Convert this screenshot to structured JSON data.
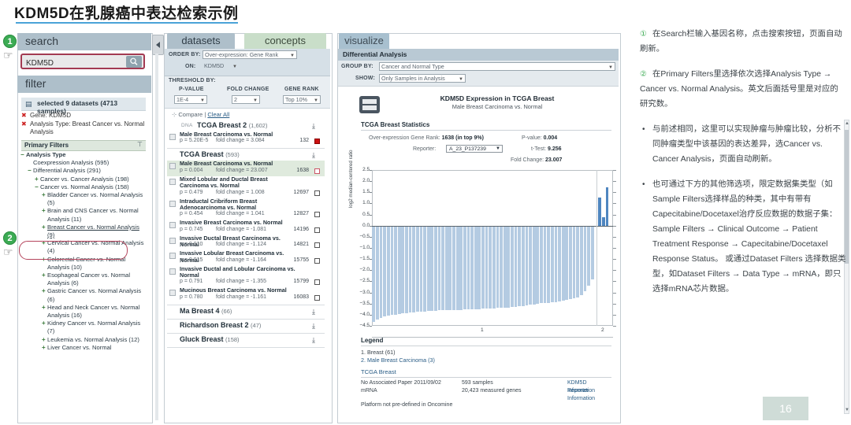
{
  "slide": {
    "title": "KDM5D在乳腺癌中表达检索示例",
    "page_number": "16"
  },
  "steps": [
    {
      "number": "1"
    },
    {
      "number": "2"
    }
  ],
  "search_panel": {
    "header": "search",
    "input_value": "KDM5D",
    "input_placeholder": "KDM5D",
    "search_icon": "search-icon",
    "filter_header": "filter",
    "selected_summary": "selected 9 datasets (4713 samples)",
    "selected_filters": [
      "Gene: KDM5D",
      "Analysis Type: Breast Cancer vs. Normal Analysis"
    ],
    "primary_filters_label": "Primary Filters",
    "tree": [
      {
        "indent": 0,
        "toggle": "−",
        "label": "Analysis Type",
        "bold": true
      },
      {
        "indent": 1,
        "toggle": "",
        "label": "Coexpression Analysis (595)",
        "bold": false
      },
      {
        "indent": 1,
        "toggle": "−",
        "label": "Differential Analysis (291)",
        "bold": false
      },
      {
        "indent": 2,
        "toggle": "+",
        "label": "Cancer vs. Cancer Analysis (198)",
        "bold": false
      },
      {
        "indent": 2,
        "toggle": "−",
        "label": "Cancer vs. Normal Analysis (158)",
        "bold": false
      },
      {
        "indent": 3,
        "toggle": "+",
        "label": "Bladder Cancer vs. Normal Analysis (5)",
        "bold": false
      },
      {
        "indent": 3,
        "toggle": "+",
        "label": "Brain and CNS Cancer vs. Normal Analysis (11)",
        "bold": false
      },
      {
        "indent": 3,
        "toggle": "+",
        "label": "Breast Cancer vs. Normal Analysis (9)",
        "bold": false,
        "highlight": true
      },
      {
        "indent": 3,
        "toggle": "+",
        "label": "Cervical Cancer vs. Normal Analysis (4)",
        "bold": false
      },
      {
        "indent": 3,
        "toggle": "+",
        "label": "Colorectal Cancer vs. Normal Analysis (10)",
        "bold": false
      },
      {
        "indent": 3,
        "toggle": "+",
        "label": "Esophageal Cancer vs. Normal Analysis (6)",
        "bold": false
      },
      {
        "indent": 3,
        "toggle": "+",
        "label": "Gastric Cancer vs. Normal Analysis (6)",
        "bold": false
      },
      {
        "indent": 3,
        "toggle": "+",
        "label": "Head and Neck Cancer vs. Normal Analysis (16)",
        "bold": false
      },
      {
        "indent": 3,
        "toggle": "+",
        "label": "Kidney Cancer vs. Normal Analysis (7)",
        "bold": false
      },
      {
        "indent": 3,
        "toggle": "+",
        "label": "Leukemia vs. Normal Analysis (12)",
        "bold": false
      },
      {
        "indent": 3,
        "toggle": "+",
        "label": "Liver Cancer vs. Normal",
        "bold": false
      }
    ]
  },
  "datasets_panel": {
    "tabs": [
      {
        "label": "datasets",
        "active": true
      },
      {
        "label": "concepts",
        "active": false
      }
    ],
    "order_by_label": "ORDER BY:",
    "order_by_value": "Over-expression: Gene Rank",
    "on_label": "ON:",
    "on_value": "KDM5D",
    "threshold_label": "THRESHOLD BY:",
    "thresholds": [
      {
        "label": "P-VALUE",
        "value": "1E-4"
      },
      {
        "label": "FOLD CHANGE",
        "value": "2"
      },
      {
        "label": "GENE RANK",
        "value": "Top 10%"
      }
    ],
    "compare_label": "Compare",
    "clear_all_label": "Clear All",
    "groups": [
      {
        "tag": "DNA",
        "name": "TCGA Breast 2",
        "count": "(1,602)",
        "rows": [
          {
            "title": "Male Breast Carcinoma vs. Normal",
            "p": "p = 5.20E-5",
            "fc": "fold change = 3.084",
            "rank": "132",
            "box": "red",
            "selected": false
          }
        ]
      },
      {
        "tag": "",
        "name": "TCGA Breast",
        "count": "(593)",
        "rows": [
          {
            "title": "Male Breast Carcinoma vs. Normal",
            "p": "p = 0.004",
            "fc": "fold change = 23.007",
            "rank": "1638",
            "box": "pink",
            "selected": true
          },
          {
            "title": "Mixed Lobular and Ductal Breast Carcinoma vs. Normal",
            "p": "p = 0.479",
            "fc": "fold change = 1.008",
            "rank": "12697",
            "box": "empty",
            "selected": false
          },
          {
            "title": "Intraductal Cribriform Breast Adenocarcinoma vs. Normal",
            "p": "p = 0.454",
            "fc": "fold change = 1.041",
            "rank": "12827",
            "box": "empty",
            "selected": false
          },
          {
            "title": "Invasive Breast Carcinoma vs. Normal",
            "p": "p = 0.745",
            "fc": "fold change = -1.081",
            "rank": "14196",
            "box": "empty",
            "selected": false
          },
          {
            "title": "Invasive Ductal Breast Carcinoma vs. Normal",
            "p": "p = 0.910",
            "fc": "fold change = -1.124",
            "rank": "14821",
            "box": "empty",
            "selected": false
          },
          {
            "title": "Invasive Lobular Breast Carcinoma vs. Normal",
            "p": "p = 0.915",
            "fc": "fold change = -1.164",
            "rank": "15755",
            "box": "empty",
            "selected": false
          },
          {
            "title": "Invasive Ductal and Lobular Carcinoma vs. Normal",
            "p": "p = 0.791",
            "fc": "fold change = -1.355",
            "rank": "15799",
            "box": "empty",
            "selected": false
          },
          {
            "title": "Mucinous Breast Carcinoma vs. Normal",
            "p": "p = 0.780",
            "fc": "fold change = -1.161",
            "rank": "16083",
            "box": "empty",
            "selected": false
          }
        ]
      },
      {
        "tag": "",
        "name": "Ma Breast 4",
        "count": "(66)",
        "rows": []
      },
      {
        "tag": "",
        "name": "Richardson Breast 2",
        "count": "(47)",
        "rows": []
      },
      {
        "tag": "",
        "name": "Gluck Breast",
        "count": "(158)",
        "rows": []
      }
    ]
  },
  "visualize_panel": {
    "tab_label": "visualize",
    "section_title": "Differential Analysis",
    "group_by_label": "GROUP BY:",
    "group_by_value": "Cancer and Normal Type",
    "show_label": "SHOW:",
    "show_value": "Only Samples in Analysis",
    "chart_title": "KDM5D Expression in TCGA Breast",
    "chart_subtitle": "Male Breast Carcinoma vs. Normal",
    "stats_header": "TCGA Breast Statistics",
    "stats": [
      {
        "label": "Over-expression Gene Rank:",
        "value": "1638 (in top 9%)"
      },
      {
        "label": "Reporter:",
        "value": "A_23_P137239"
      },
      {
        "label": "P-value:",
        "value": "0.004"
      },
      {
        "label": "t-Test:",
        "value": "9.256"
      },
      {
        "label": "Fold Change:",
        "value": "23.007"
      }
    ],
    "legend_header": "Legend",
    "legend_items": [
      "1. Breast (61)",
      "2. Male Breast Carcinoma (3)"
    ],
    "dataset_name": "TCGA Breast",
    "dataset_info": {
      "paper": "No Associated Paper 2011/09/02",
      "type": "mRNA",
      "samples": "593 samples",
      "genes": "20,423 measured genes",
      "gene_link": "KDM5D Information",
      "reporter_link": "Reporter Information"
    },
    "platform_note": "Platform not pre-defined in Oncomine"
  },
  "chart_data": {
    "type": "bar",
    "title": "KDM5D Expression in TCGA Breast",
    "subtitle": "Male Breast Carcinoma vs. Normal",
    "xlabel": "",
    "ylabel": "log2 median-centered ratio",
    "ylim": [
      -4.5,
      2.5
    ],
    "yticks": [
      2.5,
      2.0,
      1.5,
      1.0,
      0.5,
      0.0,
      -0.5,
      -1.0,
      -1.5,
      -2.0,
      -2.5,
      -3.0,
      -3.5,
      -4.0,
      -4.5
    ],
    "grid": false,
    "legend_position": "below",
    "groups": [
      {
        "index": "1",
        "name": "Breast",
        "n": 61
      },
      {
        "index": "2",
        "name": "Male Breast Carcinoma",
        "n": 3
      }
    ],
    "series": [
      {
        "name": "Breast (61)",
        "color": "#b4cbe2",
        "values": [
          -4.31,
          -4.22,
          -4.14,
          -4.08,
          -4.05,
          -4.02,
          -4.0,
          -3.97,
          -3.95,
          -3.93,
          -3.91,
          -3.9,
          -3.88,
          -3.86,
          -3.85,
          -3.84,
          -3.83,
          -3.82,
          -3.81,
          -3.8,
          -3.8,
          -3.79,
          -3.79,
          -3.78,
          -3.78,
          -3.77,
          -3.77,
          -3.76,
          -3.76,
          -3.75,
          -3.74,
          -3.73,
          -3.72,
          -3.71,
          -3.7,
          -3.69,
          -3.68,
          -3.67,
          -3.66,
          -3.64,
          -3.62,
          -3.6,
          -3.58,
          -3.56,
          -3.53,
          -3.5,
          -3.48,
          -3.47,
          -3.46,
          -3.45,
          -3.44,
          -3.42,
          -3.38,
          -3.34,
          -3.3,
          -3.26,
          -3.22,
          -3.12,
          -2.96,
          -2.7,
          -2.4
        ]
      },
      {
        "name": "Male Breast Carcinoma (3)",
        "color": "#4f86c0",
        "values": [
          1.25,
          0.38,
          1.72
        ]
      }
    ]
  },
  "notes": [
    {
      "marker": "①",
      "text": "在Search栏输入基因名称，点击搜索按钮，页面自动刷新。"
    },
    {
      "marker": "②",
      "text": "在Primary Filters里选择依次选择Analysis Type → Cancer vs. Normal Analysis。英文后面括号里是对应的研究数。"
    }
  ],
  "bullets": [
    "与前述相同，这里可以实现肿瘤与肿瘤比较，分析不同肿瘤类型中该基因的表达差异，选Cancer vs. Cancer Analysis，页面自动刷新。",
    "也可通过下方的其他筛选项，限定数据集类型（如Sample Filters选择样品的种类，其中有带有Capecitabine/Docetaxel治疗反应数据的数据子集：Sample Filters → Clinical Outcome → Patient Treatment Response → Capecitabine/Docetaxel Response Status。 或通过Dataset Filters 选择数据类型，如Dataset Filters → Data Type → mRNA，即只选择mRNA芯片数据。"
  ]
}
